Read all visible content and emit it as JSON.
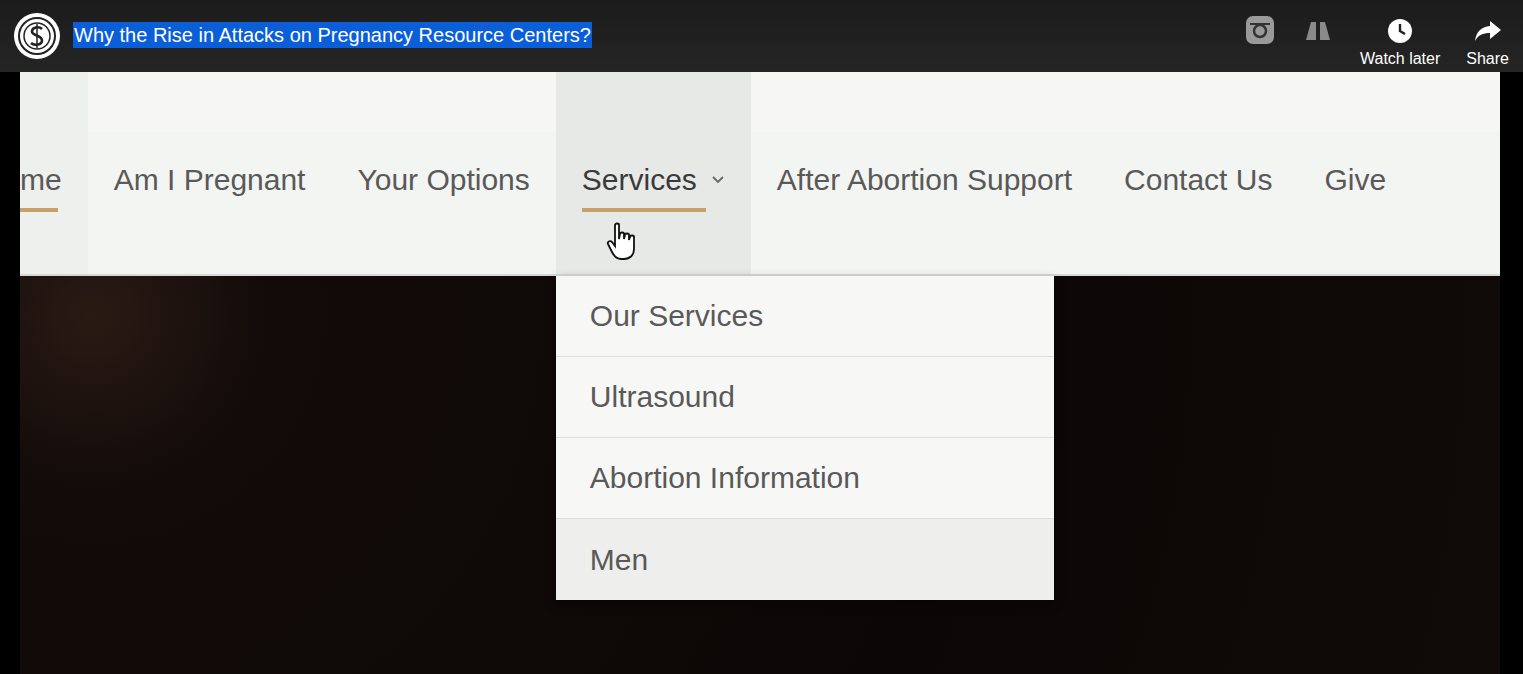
{
  "player": {
    "title": "Why the Rise in Attacks on Pregnancy Resource Centers?",
    "title_selected": true,
    "actions": [
      {
        "label": "Watch later",
        "icon": "clock"
      },
      {
        "label": "Share",
        "icon": "share"
      }
    ]
  },
  "site_nav": {
    "items": [
      {
        "label": "me",
        "selected": true,
        "hovered": false,
        "has_submenu": false
      },
      {
        "label": "Am I Pregnant",
        "selected": false,
        "hovered": false,
        "has_submenu": false
      },
      {
        "label": "Your Options",
        "selected": false,
        "hovered": false,
        "has_submenu": false
      },
      {
        "label": "Services",
        "selected": true,
        "hovered": true,
        "has_submenu": true,
        "expanded": true
      },
      {
        "label": "After Abortion Support",
        "selected": false,
        "hovered": false,
        "has_submenu": false
      },
      {
        "label": "Contact Us",
        "selected": false,
        "hovered": false,
        "has_submenu": false
      },
      {
        "label": "Give",
        "selected": false,
        "hovered": false,
        "has_submenu": false
      }
    ]
  },
  "dropdown": {
    "items": [
      "Our Services",
      "Ultrasound",
      "Abortion Information",
      "Men"
    ]
  }
}
